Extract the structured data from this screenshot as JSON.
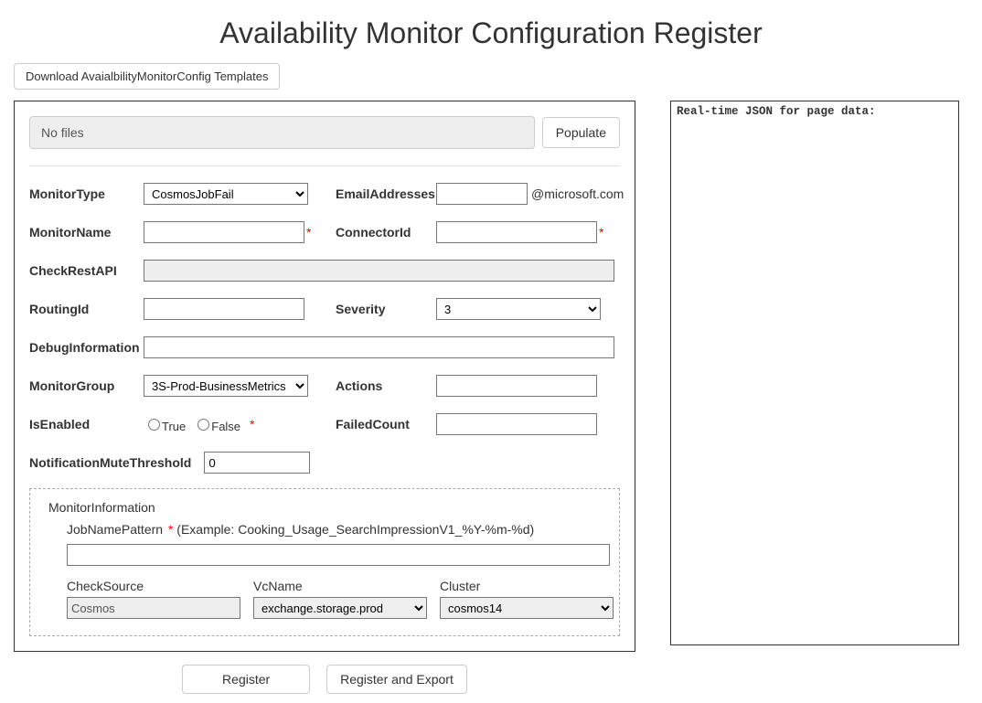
{
  "title": "Availability Monitor Configuration Register",
  "download_button": "Download AvaialbilityMonitorConfig Templates",
  "file_box": {
    "placeholder": "No files"
  },
  "populate_button": "Populate",
  "labels": {
    "monitorType": "MonitorType",
    "monitorName": "MonitorName",
    "checkRestAPI": "CheckRestAPI",
    "routingId": "RoutingId",
    "debugInformation": "DebugInformation",
    "monitorGroup": "MonitorGroup",
    "isEnabled": "IsEnabled",
    "notificationMuteThreshold": "NotificationMuteThreshold",
    "emailAddresses": "EmailAddresses",
    "connectorId": "ConnectorId",
    "severity": "Severity",
    "actions": "Actions",
    "failedCount": "FailedCount",
    "trueLabel": "True",
    "falseLabel": "False",
    "emailSuffix": "@microsoft.com"
  },
  "values": {
    "monitorType": "CosmosJobFail",
    "monitorName": "",
    "checkRestAPI": "",
    "routingId": "",
    "debugInformation": "",
    "monitorGroup": "3S-Prod-BusinessMetrics",
    "notificationMuteThreshold": "0",
    "emailAddresses": "",
    "connectorId": "",
    "severity": "3",
    "actions": "",
    "failedCount": ""
  },
  "monitorInfo": {
    "legend": "MonitorInformation",
    "jobNamePatternLabel": "JobNamePattern",
    "jobNamePatternHint": "(Example: Cooking_Usage_SearchImpressionV1_%Y-%m-%d)",
    "jobNamePattern": "",
    "checkSourceLabel": "CheckSource",
    "checkSource": "Cosmos",
    "vcNameLabel": "VcName",
    "vcName": "exchange.storage.prod",
    "clusterLabel": "Cluster",
    "cluster": "cosmos14"
  },
  "actions_buttons": {
    "register": "Register",
    "registerExport": "Register and Export"
  },
  "json_panel": {
    "header": "Real-time JSON for page data:"
  }
}
